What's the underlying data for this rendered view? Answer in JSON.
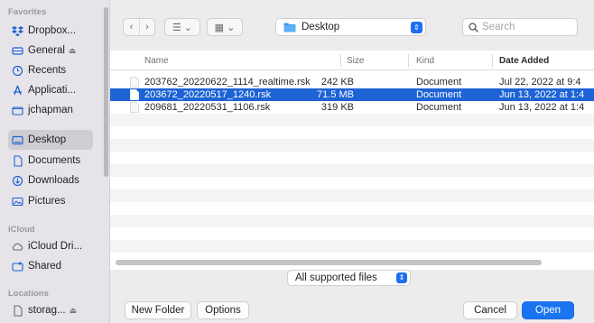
{
  "sidebar": {
    "sections": {
      "favorites": "Favorites",
      "icloud": "iCloud",
      "locations": "Locations"
    },
    "favorites": [
      {
        "label": "Dropbox..."
      },
      {
        "label": "General"
      },
      {
        "label": "Recents"
      },
      {
        "label": "Applicati..."
      },
      {
        "label": "jchapman"
      },
      {
        "label": "Desktop"
      },
      {
        "label": "Documents"
      },
      {
        "label": "Downloads"
      },
      {
        "label": "Pictures"
      }
    ],
    "icloud": [
      {
        "label": "iCloud Dri..."
      },
      {
        "label": "Shared"
      }
    ],
    "locations": [
      {
        "label": "storag..."
      }
    ],
    "selected": "Desktop"
  },
  "toolbar": {
    "location": "Desktop",
    "search_placeholder": "Search",
    "back_glyph": "‹",
    "forward_glyph": "›",
    "list_view_glyph": "☰ ⌄",
    "grid_view_glyph": "▦ ⌄"
  },
  "columns": {
    "name": "Name",
    "size": "Size",
    "kind": "Kind",
    "date_added": "Date Added"
  },
  "files": [
    {
      "name": "203762_20220622_1114_realtime.rsk",
      "size": "242 KB",
      "kind": "Document",
      "date": "Jul 22, 2022 at 9:4",
      "selected": false
    },
    {
      "name": "203672_20220517_1240.rsk",
      "size": "71.5 MB",
      "kind": "Document",
      "date": "Jun 13, 2022 at 1:4",
      "selected": true
    },
    {
      "name": "209681_20220531_1106.rsk",
      "size": "319 KB",
      "kind": "Document",
      "date": "Jun 13, 2022 at 1:4",
      "selected": false
    }
  ],
  "format": {
    "selected": "All supported files"
  },
  "buttons": {
    "new_folder": "New Folder",
    "options": "Options",
    "cancel": "Cancel",
    "open": "Open"
  },
  "colors": {
    "accent": "#1a73f0",
    "selection": "#1e63d6",
    "sidebar_selection": "#cfcdd3"
  }
}
